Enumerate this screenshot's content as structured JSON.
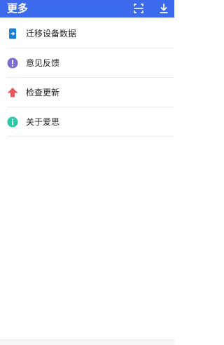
{
  "header": {
    "title": "更多",
    "background_color": "#3b6bea",
    "actions": [
      {
        "icon": "scan-icon"
      },
      {
        "icon": "download-icon"
      }
    ]
  },
  "menu": {
    "items": [
      {
        "label": "迁移设备数据",
        "icon": "migrate-device-icon",
        "icon_color": "#1a7fd6"
      },
      {
        "label": "意见反馈",
        "icon": "feedback-icon",
        "icon_color": "#7b6ccf"
      },
      {
        "label": "检查更新",
        "icon": "update-arrow-icon",
        "icon_color": "#e8575b"
      },
      {
        "label": "关于爱思",
        "icon": "info-icon",
        "icon_color": "#2fc6a8"
      }
    ]
  }
}
